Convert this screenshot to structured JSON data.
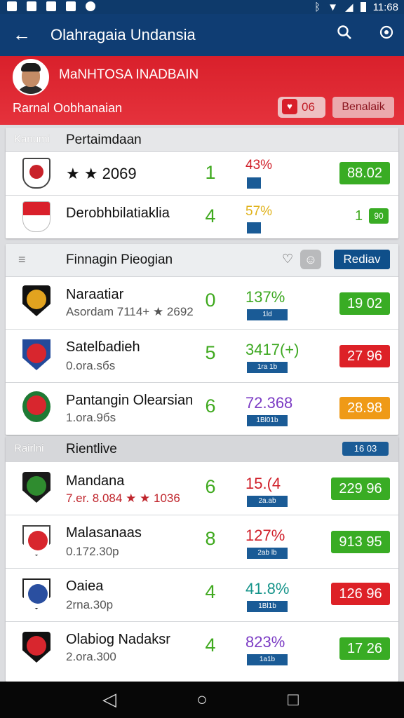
{
  "status": {
    "time": "11:68"
  },
  "appbar": {
    "title": "Olahragaia Undansia"
  },
  "profile": {
    "name": "MaNHTOSA INADBAIN",
    "subtitle": "Rarnal Oobhanaian",
    "badge": "06",
    "detail": "Benalaik"
  },
  "section1": {
    "category": "Kanumi",
    "title": "Pertaimdaan",
    "rows": [
      {
        "team": "★ ★ 2069",
        "score": "1",
        "pct": "43%",
        "value": "88.02",
        "pct_color": "#d0202a",
        "value_color": "#39ac24",
        "score_color": "#3fa91e"
      },
      {
        "team": "Derobhbilatiaklia",
        "score": "4",
        "pct": "57%",
        "value": "1",
        "value2": "90",
        "pct_color": "#e0b21a",
        "value_color": "#39ac24",
        "score_color": "#3fa91e"
      }
    ]
  },
  "section2": {
    "title": "Finnagin Pieogian",
    "action": "Rediav",
    "rows": [
      {
        "team": "Naraatiar",
        "sub": "Asordam 7114+ ★ 2692",
        "score": "0",
        "pct": "137%",
        "mini": "1ld",
        "value": "19 02",
        "pct_color": "#3da821",
        "value_color": "#39ac24",
        "score_color": "#3fa91e",
        "sub_color": "#555"
      },
      {
        "team": "Satelɓadieh",
        "sub": "0.ora.sбs",
        "score": "5",
        "pct": "3417(+)",
        "mini": "1ra 1b",
        "value": "27 96",
        "pct_color": "#3da821",
        "value_color": "#dd2127",
        "score_color": "#3fa91e",
        "sub_color": "#555"
      },
      {
        "team": "Pantangin Olearsian",
        "sub": "1.ora.9бs",
        "score": "6",
        "pct": "72.368",
        "mini": "1Bl01b",
        "value": "28.98",
        "pct_color": "#7b3bc4",
        "value_color": "#ef9a17",
        "score_color": "#3fa91e",
        "sub_color": "#555"
      }
    ]
  },
  "section3": {
    "category": "Rairlni",
    "title": "Rientlive",
    "badge": "16 03",
    "rows": [
      {
        "team": "Mandana",
        "sub": "7.er. 8.084 ★ ★ 1036",
        "score": "6",
        "pct": "15.(4",
        "mini": "2a.ab",
        "value": "229 96",
        "pct_color": "#d0202a",
        "value_color": "#39ac24",
        "score_color": "#3fa91e",
        "sub_color": "#c0262d"
      },
      {
        "team": "Malasanaas",
        "sub": "0.172.30p",
        "score": "8",
        "pct": "127%",
        "mini": "2ab lb",
        "value": "913 95",
        "pct_color": "#d0202a",
        "value_color": "#39ac24",
        "score_color": "#3fa91e",
        "sub_color": "#555"
      },
      {
        "team": "Oaiea",
        "sub": "2rna.30p",
        "score": "4",
        "pct": "41.8%",
        "mini": "1Bl1b",
        "value": "126 96",
        "pct_color": "#15948a",
        "value_color": "#dd2127",
        "score_color": "#3fa91e",
        "sub_color": "#555"
      },
      {
        "team": "Olabiog Nadaksr",
        "sub": "2.ora.300",
        "score": "4",
        "pct": "823%",
        "mini": "1a1b",
        "value": "17 26",
        "pct_color": "#7b3bc4",
        "value_color": "#39ac24",
        "score_color": "#3fa91e",
        "sub_color": "#555"
      }
    ]
  },
  "colors": {
    "appbar": "#0f3d73",
    "header_red": "#d9202b",
    "action_blue": "#0f4f8a"
  },
  "icons": {
    "back": "arrow-left-icon",
    "search": "search-icon",
    "settings": "target-icon"
  }
}
